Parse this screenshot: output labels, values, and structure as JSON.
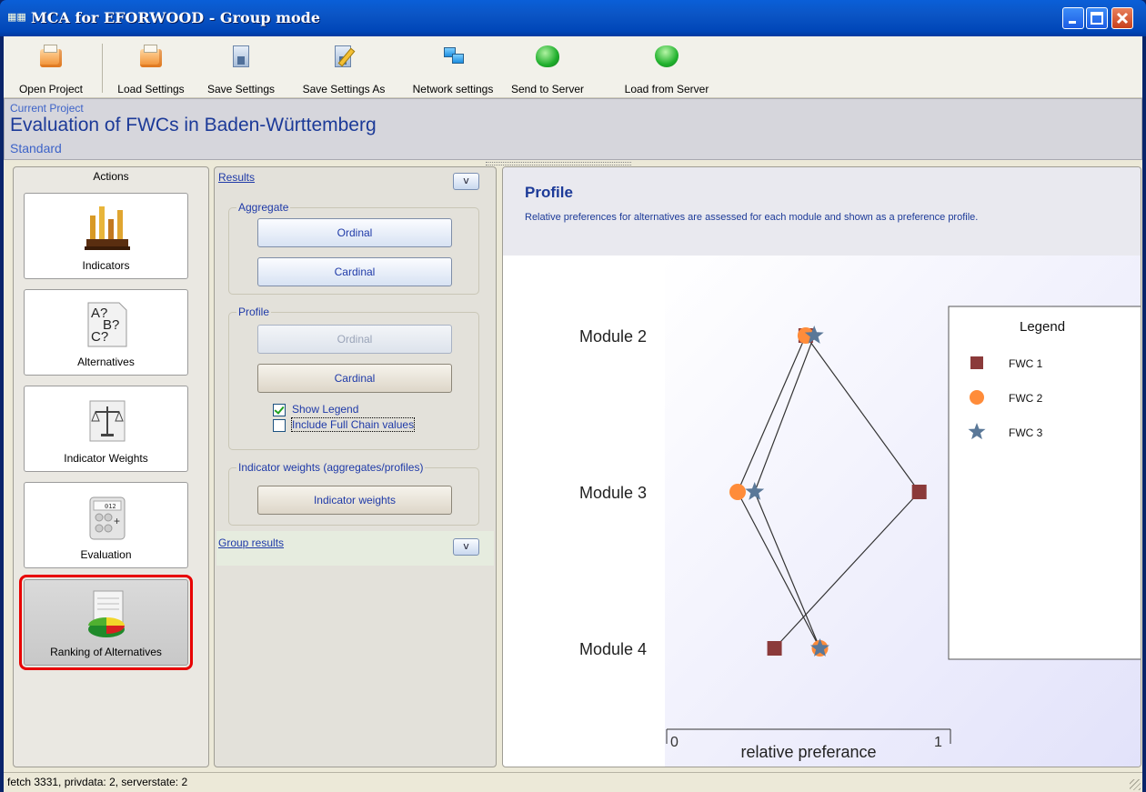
{
  "window": {
    "title": "MCA for EFORWOOD - Group mode"
  },
  "toolbar": {
    "open_project": "Open Project",
    "load_settings": "Load Settings",
    "save_settings": "Save Settings",
    "save_settings_as": "Save Settings As",
    "network_settings": "Network settings",
    "send_to_server": "Send to Server",
    "load_from_server": "Load from Server"
  },
  "project": {
    "caption": "Current Project",
    "name": "Evaluation of FWCs in Baden-Württemberg",
    "variant": "Standard"
  },
  "actions": {
    "header": "Actions",
    "items": [
      {
        "label": "Indicators",
        "icon": "bar-chart-icon"
      },
      {
        "label": "Alternatives",
        "icon": "question-marks-icon"
      },
      {
        "label": "Indicator Weights",
        "icon": "scales-icon"
      },
      {
        "label": "Evaluation",
        "icon": "calculator-icon",
        "display": "012"
      },
      {
        "label": "Ranking of Alternatives",
        "icon": "pie-report-icon",
        "selected": true
      }
    ]
  },
  "results": {
    "header": "Results",
    "toggle": "v",
    "aggregate": {
      "legend": "Aggregate",
      "ordinal": "Ordinal",
      "cardinal": "Cardinal"
    },
    "profile": {
      "legend": "Profile",
      "ordinal": "Ordinal",
      "cardinal": "Cardinal",
      "show_legend": "Show Legend",
      "show_legend_checked": true,
      "include_full_chain": "Include Full Chain values",
      "include_full_chain_checked": false
    },
    "weights": {
      "legend": "Indicator weights (aggregates/profiles)",
      "button": "Indicator weights"
    },
    "group_results": "Group results",
    "group_toggle": "v"
  },
  "profile_panel": {
    "title": "Profile",
    "description": "Relative preferences for alternatives are assessed for each module and shown as a preference profile."
  },
  "chart_data": {
    "type": "scatter",
    "categories": [
      "Module 2",
      "Module 3",
      "Module 4"
    ],
    "xlabel": "relative preferance",
    "xlim": [
      0,
      1
    ],
    "x_tick_labels": [
      "0",
      "1"
    ],
    "legend_title": "Legend",
    "legend_position": "right",
    "series": [
      {
        "name": "FWC 1",
        "marker": "square",
        "color": "#8b3a3a",
        "values": [
          0.49,
          0.89,
          0.38
        ]
      },
      {
        "name": "FWC 2",
        "marker": "circle",
        "color": "#ff8c3a",
        "values": [
          0.49,
          0.25,
          0.54
        ]
      },
      {
        "name": "FWC 3",
        "marker": "star",
        "color": "#5a7898",
        "values": [
          0.52,
          0.31,
          0.54
        ]
      }
    ]
  },
  "status": {
    "text": "fetch 3331, privdata: 2, serverstate: 2"
  }
}
